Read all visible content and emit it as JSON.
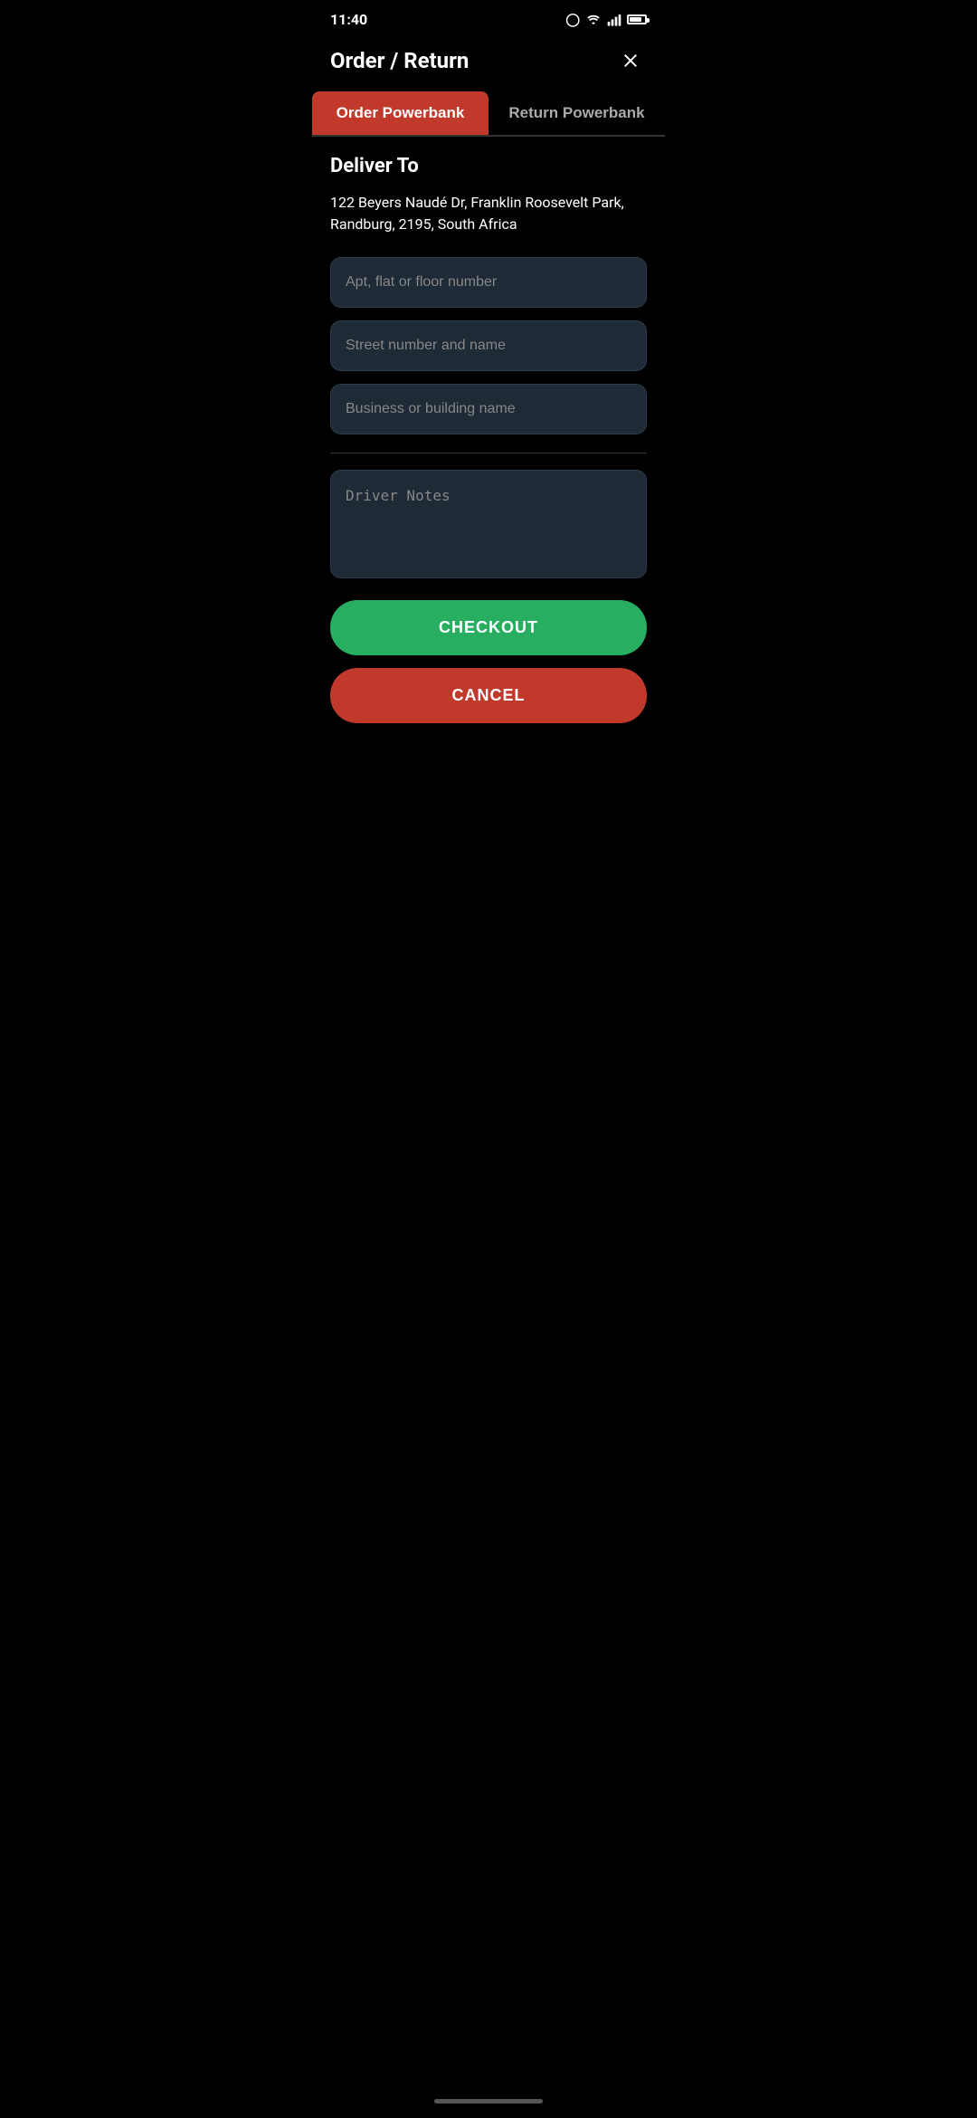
{
  "statusBar": {
    "time": "11:40",
    "wifiIcon": "wifi-icon",
    "signalIcon": "signal-icon",
    "batteryIcon": "battery-icon"
  },
  "header": {
    "title": "Order / Return",
    "closeIcon": "close-icon"
  },
  "tabs": [
    {
      "label": "Order Powerbank",
      "active": true
    },
    {
      "label": "Return Powerbank",
      "active": false
    }
  ],
  "deliverTo": {
    "sectionTitle": "Deliver To",
    "address": "122 Beyers Naudé Dr, Franklin Roosevelt Park, Randburg, 2195, South Africa"
  },
  "form": {
    "aptPlaceholder": "Apt, flat or floor number",
    "streetPlaceholder": "Street number and name",
    "buildingPlaceholder": "Business or building name",
    "driverNotesPlaceholder": "Driver Notes"
  },
  "buttons": {
    "checkout": "CHECKOUT",
    "cancel": "CANCEL"
  }
}
